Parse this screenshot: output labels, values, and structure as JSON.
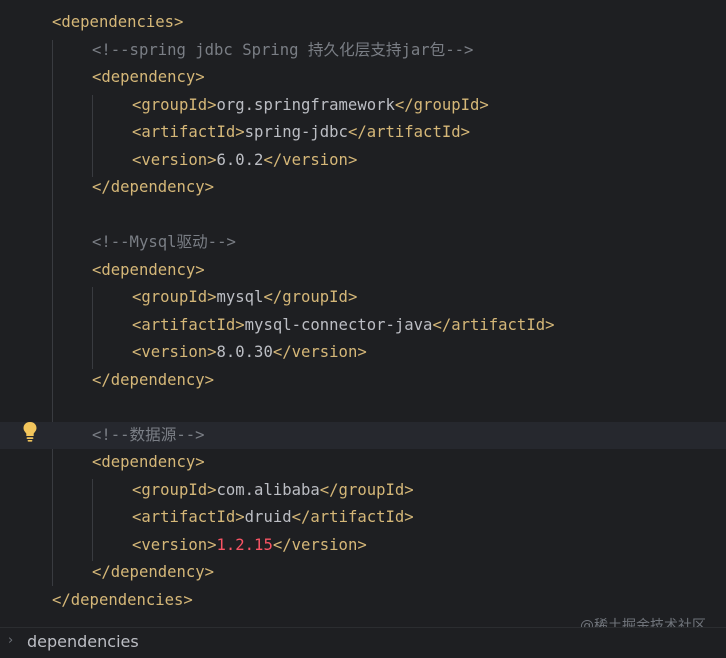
{
  "editor": {
    "lines": [
      {
        "open": "<dependencies>",
        "cls": "tag"
      },
      {
        "comment": "<!--spring jdbc Spring 持久化层支持jar包-->"
      },
      {
        "open": "<dependency>"
      },
      {
        "open": "<groupId>",
        "value": "org.springframework",
        "close": "</groupId>"
      },
      {
        "open": "<artifactId>",
        "value": "spring-jdbc",
        "close": "</artifactId>"
      },
      {
        "open": "<version>",
        "value": "6.0.2",
        "close": "</version>"
      },
      {
        "open": "</dependency>"
      },
      {
        "comment": "<!--Mysql驱动-->"
      },
      {
        "open": "<dependency>"
      },
      {
        "open": "<groupId>",
        "value": "mysql",
        "close": "</groupId>"
      },
      {
        "open": "<artifactId>",
        "value": "mysql-connector-java",
        "close": "</artifactId>"
      },
      {
        "open": "<version>",
        "value": "8.0.30",
        "close": "</version>"
      },
      {
        "open": "</dependency>"
      },
      {
        "comment": "<!--数据源-->"
      },
      {
        "open": "<dependency>"
      },
      {
        "open": "<groupId>",
        "value": "com.alibaba",
        "close": "</groupId>"
      },
      {
        "open": "<artifactId>",
        "value": "druid",
        "close": "</artifactId>"
      },
      {
        "open": "<version>",
        "value": "1.2.15",
        "close": "</version>"
      },
      {
        "open": "</dependency>"
      },
      {
        "open": "</dependencies>"
      }
    ]
  },
  "colors": {
    "tag": "#d5b778",
    "text": "#bcbec4",
    "comment": "#7a7e85",
    "highlight": "#f75464",
    "background": "#1e1f22"
  },
  "icons": {
    "gutter": "lightbulb-icon",
    "breadcrumb": "chevron-right-icon"
  },
  "breadcrumb": {
    "label": "dependencies"
  },
  "watermark": {
    "text": "@稀土掘金技术社区"
  }
}
